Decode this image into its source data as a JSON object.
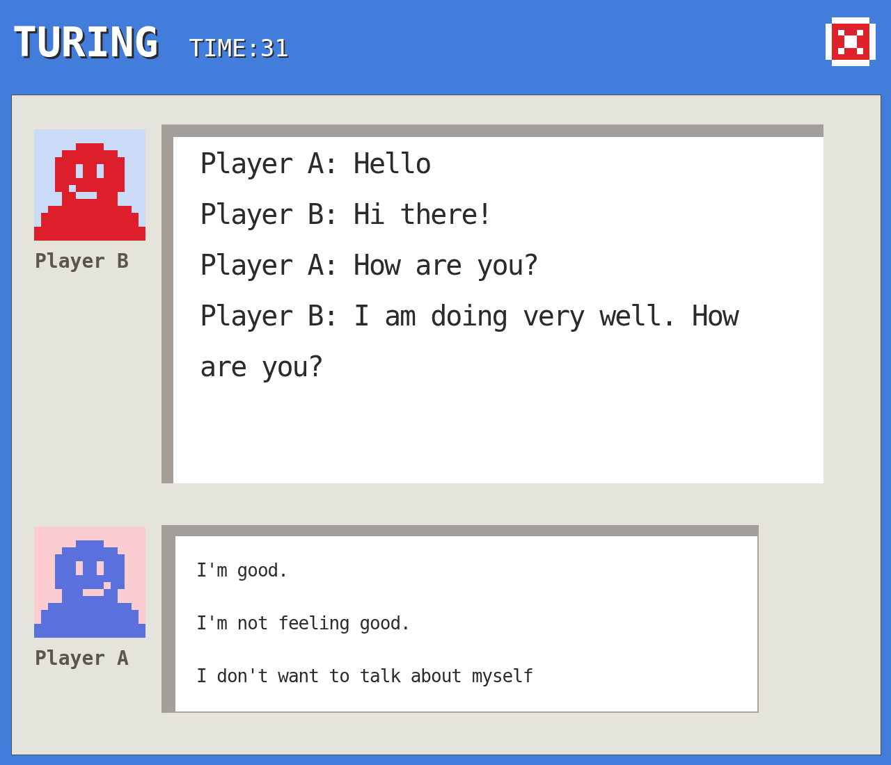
{
  "window": {
    "title": "TURING",
    "timer": "TIME:31"
  },
  "conversation": {
    "player": "Player B",
    "messages": [
      "Player A: Hello",
      "Player B: Hi there!",
      "Player A: How are you?",
      "Player B: I am doing very well. How are you?"
    ]
  },
  "reply": {
    "player": "Player A",
    "options": [
      "I'm good.",
      "I'm not feeling good.",
      "I don't want to talk about myself"
    ]
  }
}
